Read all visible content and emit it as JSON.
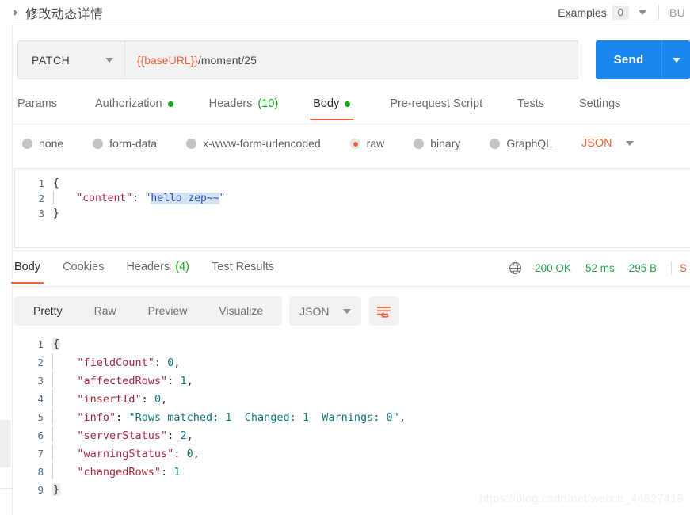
{
  "titlebar": {
    "title": "修改动态详情",
    "expand_icon": "caret-right-icon",
    "examples_label": "Examples",
    "examples_count": "0",
    "dropdown_icon": "chevron-down-icon",
    "bu_text": "BU"
  },
  "url_bar": {
    "method": "PATCH",
    "method_caret": "chevron-down-icon",
    "url_variable": "{{baseURL}}",
    "url_path": "/moment/25",
    "send_label": "Send",
    "send_caret": "chevron-down-icon"
  },
  "request_tabs": [
    {
      "label": "Params",
      "active": false,
      "indicator": ""
    },
    {
      "label": "Authorization",
      "active": false,
      "indicator": "dot"
    },
    {
      "label": "Headers",
      "active": false,
      "indicator": "count",
      "count": "(10)"
    },
    {
      "label": "Body",
      "active": true,
      "indicator": "dot"
    },
    {
      "label": "Pre-request Script",
      "active": false,
      "indicator": ""
    },
    {
      "label": "Tests",
      "active": false,
      "indicator": ""
    },
    {
      "label": "Settings",
      "active": false,
      "indicator": ""
    }
  ],
  "body_types": {
    "options": [
      {
        "label": "none",
        "selected": false
      },
      {
        "label": "form-data",
        "selected": false
      },
      {
        "label": "x-www-form-urlencoded",
        "selected": false
      },
      {
        "label": "raw",
        "selected": true
      },
      {
        "label": "binary",
        "selected": false
      },
      {
        "label": "GraphQL",
        "selected": false
      }
    ],
    "format": "JSON",
    "format_caret": "chevron-down-icon"
  },
  "request_body": {
    "lines": [
      {
        "num": "1",
        "open_brace": "{"
      },
      {
        "num": "2",
        "key": "\"content\"",
        "colon": ": ",
        "quote_open": "\"",
        "value": "hello zep~~",
        "quote_close": "\""
      },
      {
        "num": "3",
        "close_brace": "}"
      }
    ]
  },
  "response_tabs": [
    {
      "label": "Body",
      "active": true,
      "indicator": ""
    },
    {
      "label": "Cookies",
      "active": false,
      "indicator": ""
    },
    {
      "label": "Headers",
      "active": false,
      "indicator": "count",
      "count": "(4)"
    },
    {
      "label": "Test Results",
      "active": false,
      "indicator": ""
    }
  ],
  "response_meta": {
    "globe_icon": "globe-icon",
    "status": "200 OK",
    "time": "52 ms",
    "size": "295 B",
    "save_label": "S"
  },
  "response_toolbar": {
    "segments": [
      {
        "label": "Pretty",
        "active": true
      },
      {
        "label": "Raw",
        "active": false
      },
      {
        "label": "Preview",
        "active": false
      },
      {
        "label": "Visualize",
        "active": false
      }
    ],
    "format": "JSON",
    "format_caret": "chevron-down-icon",
    "wrap_icon": "word-wrap-icon"
  },
  "response_body": {
    "lines": [
      {
        "num": "1",
        "type": "brace",
        "text": "{"
      },
      {
        "num": "2",
        "type": "kv",
        "key": "\"fieldCount\"",
        "colon": ": ",
        "value": "0",
        "value_kind": "num",
        "comma": ","
      },
      {
        "num": "3",
        "type": "kv",
        "key": "\"affectedRows\"",
        "colon": ": ",
        "value": "1",
        "value_kind": "num",
        "comma": ","
      },
      {
        "num": "4",
        "type": "kv",
        "key": "\"insertId\"",
        "colon": ": ",
        "value": "0",
        "value_kind": "num",
        "comma": ","
      },
      {
        "num": "5",
        "type": "kv",
        "key": "\"info\"",
        "colon": ": ",
        "value": "\"Rows matched: 1  Changed: 1  Warnings: 0\"",
        "value_kind": "str",
        "comma": ","
      },
      {
        "num": "6",
        "type": "kv",
        "key": "\"serverStatus\"",
        "colon": ": ",
        "value": "2",
        "value_kind": "num",
        "comma": ","
      },
      {
        "num": "7",
        "type": "kv",
        "key": "\"warningStatus\"",
        "colon": ": ",
        "value": "0",
        "value_kind": "num",
        "comma": ","
      },
      {
        "num": "8",
        "type": "kv",
        "key": "\"changedRows\"",
        "colon": ": ",
        "value": "1",
        "value_kind": "num",
        "comma": ""
      },
      {
        "num": "9",
        "type": "brace",
        "text": "}"
      }
    ]
  },
  "watermark": "https://blog.csdn.net/weixin_44827418",
  "colors": {
    "accent_orange": "#f0663b",
    "send_blue": "#1a87ef",
    "status_green": "#2aa14a",
    "indicator_green": "#17a81a",
    "json_key": "#a8263d",
    "json_string": "#0d7a7a",
    "request_string": "#2a4fb8"
  }
}
